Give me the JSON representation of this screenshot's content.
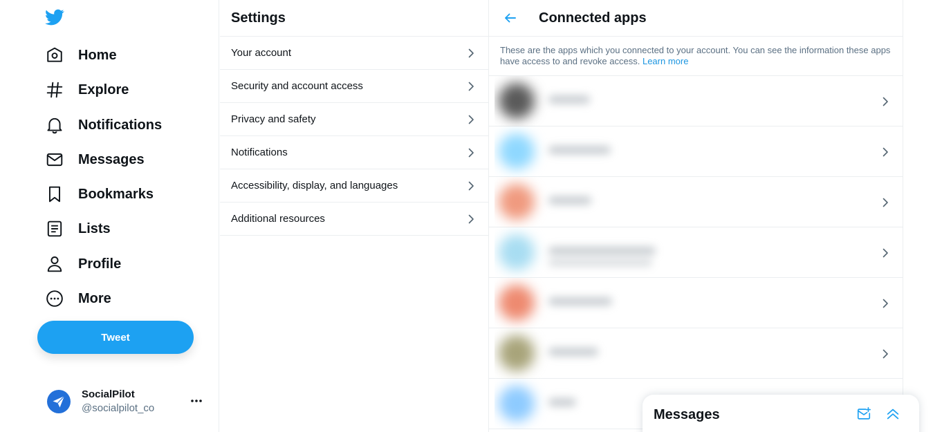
{
  "nav": {
    "items": [
      {
        "label": "Home",
        "icon": "home-icon"
      },
      {
        "label": "Explore",
        "icon": "hashtag-icon"
      },
      {
        "label": "Notifications",
        "icon": "bell-icon"
      },
      {
        "label": "Messages",
        "icon": "envelope-icon"
      },
      {
        "label": "Bookmarks",
        "icon": "bookmark-icon"
      },
      {
        "label": "Lists",
        "icon": "list-icon"
      },
      {
        "label": "Profile",
        "icon": "person-icon"
      },
      {
        "label": "More",
        "icon": "more-circle-icon"
      }
    ],
    "tweet_label": "Tweet"
  },
  "account": {
    "name": "SocialPilot",
    "handle": "@socialpilot_co"
  },
  "settings": {
    "title": "Settings",
    "items": [
      {
        "label": "Your account"
      },
      {
        "label": "Security and account access"
      },
      {
        "label": "Privacy and safety"
      },
      {
        "label": "Notifications"
      },
      {
        "label": "Accessibility, display, and languages"
      },
      {
        "label": "Additional resources"
      }
    ]
  },
  "connected_apps": {
    "title": "Connected apps",
    "description": "These are the apps which you connected to your account. You can see the information these apps have access to and revoke access.",
    "learn_more": "Learn more",
    "apps": [
      {
        "avatar_color": "#5a5a5a"
      },
      {
        "avatar_color": "#8fd8ff"
      },
      {
        "avatar_color": "#f09a7f"
      },
      {
        "avatar_color": "#a8ddf2"
      },
      {
        "avatar_color": "#ee8a70"
      },
      {
        "avatar_color": "#a8a47a"
      },
      {
        "avatar_color": "#8ecbff"
      }
    ]
  },
  "messages_drawer": {
    "title": "Messages"
  },
  "colors": {
    "accent": "#1da1f2",
    "link": "#1b95e0",
    "text": "#0f1419",
    "muted": "#5b7083",
    "border": "#ebeef0"
  }
}
